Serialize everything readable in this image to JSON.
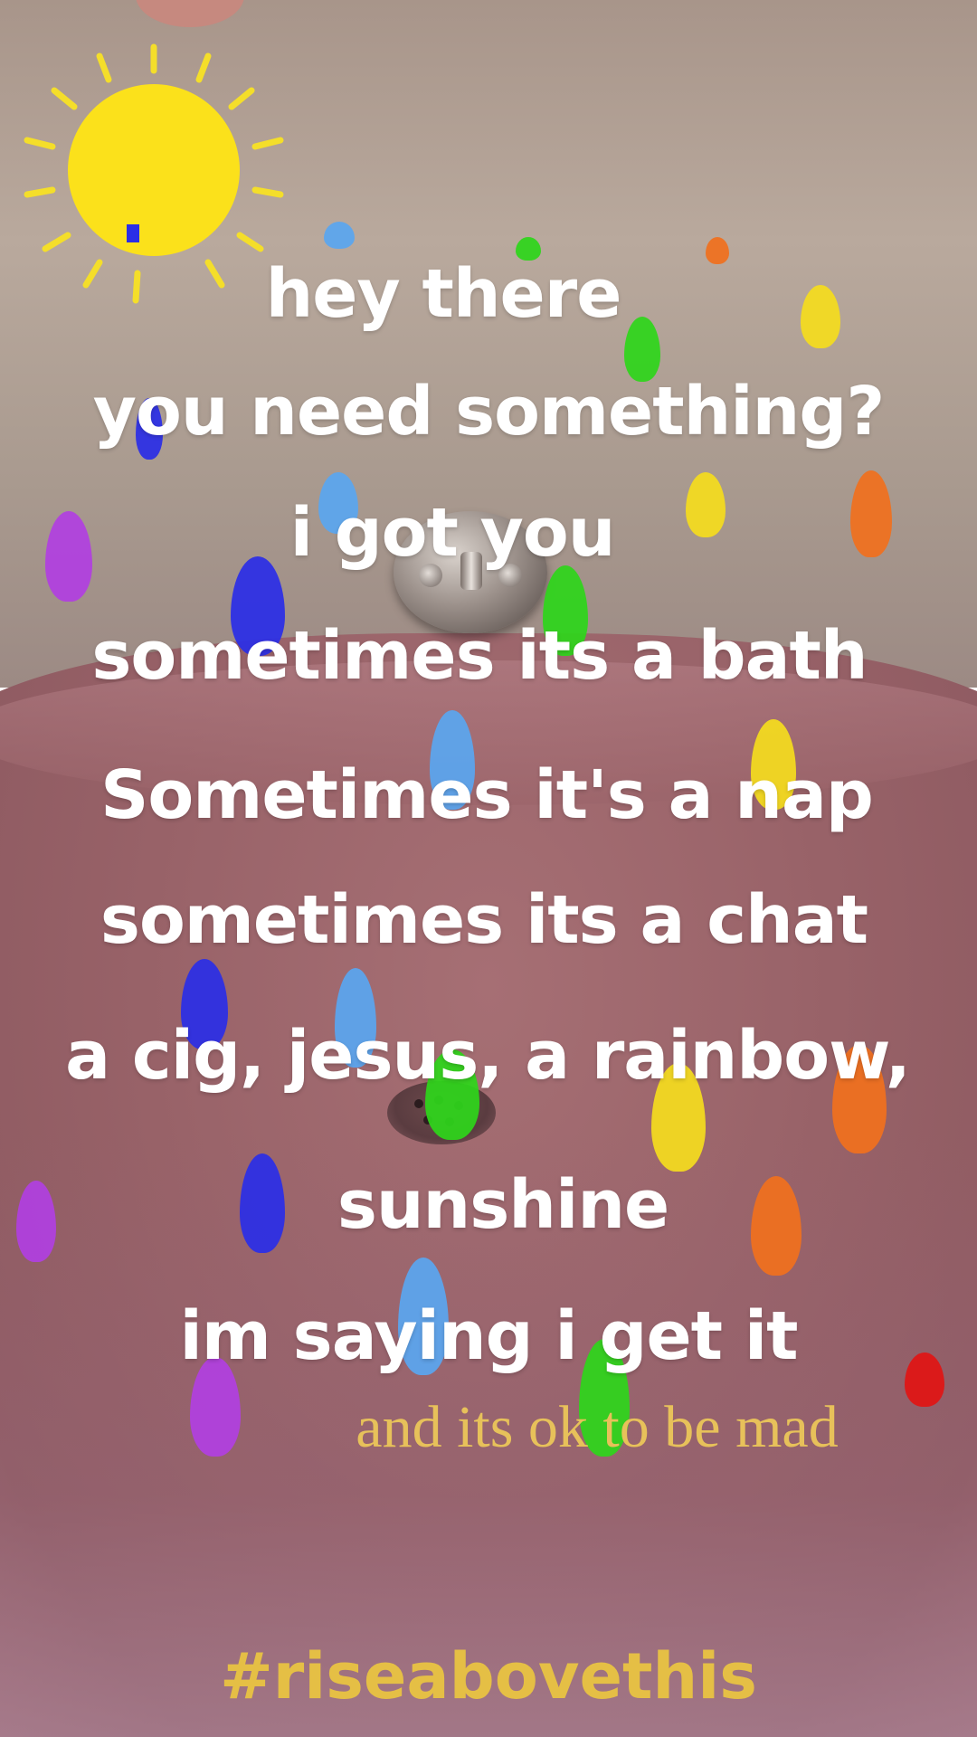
{
  "lyrics": [
    "hey there",
    "you need something?",
    "i got you",
    "sometimes its a bath",
    "Sometimes it's a nap",
    "sometimes its a chat",
    "a cig, jesus, a rainbow,",
    "sunshine",
    "im saying i get it"
  ],
  "subtitle": "and its ok to be mad",
  "hashtag": "#riseabovethis",
  "colors": {
    "sun": "#fbe11b",
    "sun_rays": "#f4de2a",
    "lyric_text": "#ffffff",
    "subtitle_text": "#e7c15a",
    "hashtag_text": "#e5bf45",
    "raindrop_colors": [
      "#2b2ee6",
      "#5aa6ef",
      "#2ed51b",
      "#f4dc1e",
      "#f0701e",
      "#b03fe0",
      "#e11414"
    ]
  },
  "icons": [
    "sun-icon",
    "raindrop-icon"
  ]
}
